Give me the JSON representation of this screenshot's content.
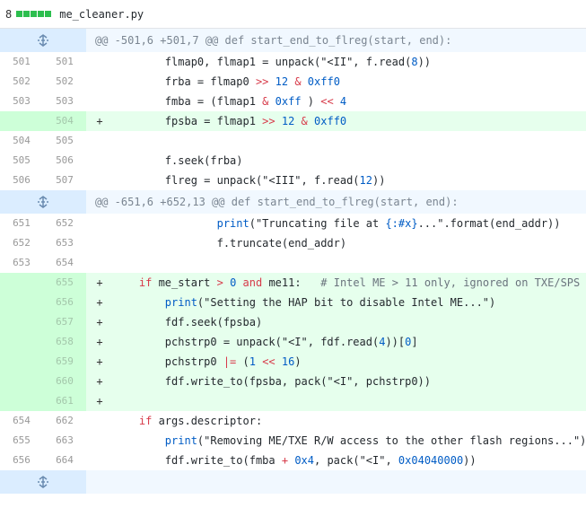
{
  "file": {
    "changes": "8",
    "name": "me_cleaner.py"
  },
  "hunks": [
    {
      "header": "@@ -501,6 +501,7 @@ def start_end_to_flreg(start, end):",
      "lines": [
        {
          "type": "ctx",
          "old": "501",
          "new": "501",
          "tokens": [
            [
              "",
              "        flmap0, flmap1 = unpack(\"<II\", f.read(",
              ""
            ],
            [
              "n",
              "8"
            ],
            [
              "",
              "))"
            ]
          ]
        },
        {
          "type": "ctx",
          "old": "502",
          "new": "502",
          "tokens": [
            [
              "",
              "        frba = flmap0 "
            ],
            [
              "o",
              ">>"
            ],
            [
              "",
              " "
            ],
            [
              "n",
              "12"
            ],
            [
              "",
              " "
            ],
            [
              "o",
              "&"
            ],
            [
              "",
              " "
            ],
            [
              "n",
              "0xff0"
            ]
          ]
        },
        {
          "type": "ctx",
          "old": "503",
          "new": "503",
          "tokens": [
            [
              "",
              "        fmba = (flmap1 "
            ],
            [
              "o",
              "&"
            ],
            [
              "",
              " "
            ],
            [
              "n",
              "0xff"
            ],
            [
              "",
              " ) "
            ],
            [
              "o",
              "<<"
            ],
            [
              "",
              " "
            ],
            [
              "n",
              "4"
            ]
          ]
        },
        {
          "type": "add",
          "old": "",
          "new": "504",
          "tokens": [
            [
              "",
              "        fpsba = flmap1 "
            ],
            [
              "o",
              ">>"
            ],
            [
              "",
              " "
            ],
            [
              "n",
              "12"
            ],
            [
              "",
              " "
            ],
            [
              "o",
              "&"
            ],
            [
              "",
              " "
            ],
            [
              "n",
              "0xff0"
            ]
          ]
        },
        {
          "type": "ctx",
          "old": "504",
          "new": "505",
          "tokens": []
        },
        {
          "type": "ctx",
          "old": "505",
          "new": "506",
          "tokens": [
            [
              "",
              "        f.seek(frba)"
            ]
          ]
        },
        {
          "type": "ctx",
          "old": "506",
          "new": "507",
          "tokens": [
            [
              "",
              "        flreg = unpack(\"<III\", f.read("
            ],
            [
              "n",
              "12"
            ],
            [
              "",
              "))"
            ]
          ]
        }
      ]
    },
    {
      "header": "@@ -651,6 +652,13 @@ def start_end_to_flreg(start, end):",
      "lines": [
        {
          "type": "ctx",
          "old": "651",
          "new": "652",
          "tokens": [
            [
              "",
              "                "
            ],
            [
              "f",
              "print"
            ],
            [
              "",
              "(\"Truncating file at "
            ],
            [
              "n",
              "{:#x}"
            ],
            [
              "",
              "...\".format(end_addr))"
            ]
          ]
        },
        {
          "type": "ctx",
          "old": "652",
          "new": "653",
          "tokens": [
            [
              "",
              "                f.truncate(end_addr)"
            ]
          ]
        },
        {
          "type": "ctx",
          "old": "653",
          "new": "654",
          "tokens": []
        },
        {
          "type": "add",
          "old": "",
          "new": "655",
          "tokens": [
            [
              "",
              "    "
            ],
            [
              "k",
              "if"
            ],
            [
              "",
              " me_start "
            ],
            [
              "o",
              ">"
            ],
            [
              "",
              " "
            ],
            [
              "n",
              "0"
            ],
            [
              "",
              " "
            ],
            [
              "k",
              "and"
            ],
            [
              "",
              " me11:   "
            ],
            [
              "c",
              "# Intel ME > 11 only, ignored on TXE/SPS"
            ]
          ]
        },
        {
          "type": "add",
          "old": "",
          "new": "656",
          "tokens": [
            [
              "",
              "        "
            ],
            [
              "f",
              "print"
            ],
            [
              "",
              "(\"Setting the HAP bit to disable Intel ME...\")"
            ]
          ]
        },
        {
          "type": "add",
          "old": "",
          "new": "657",
          "tokens": [
            [
              "",
              "        fdf.seek(fpsba)"
            ]
          ]
        },
        {
          "type": "add",
          "old": "",
          "new": "658",
          "tokens": [
            [
              "",
              "        pchstrp0 = unpack(\"<I\", fdf.read("
            ],
            [
              "n",
              "4"
            ],
            [
              "",
              "))["
            ],
            [
              "n",
              "0"
            ],
            [
              "",
              "]"
            ]
          ]
        },
        {
          "type": "add",
          "old": "",
          "new": "659",
          "tokens": [
            [
              "",
              "        pchstrp0 "
            ],
            [
              "o",
              "|="
            ],
            [
              "",
              " ("
            ],
            [
              "n",
              "1"
            ],
            [
              "",
              " "
            ],
            [
              "o",
              "<<"
            ],
            [
              "",
              " "
            ],
            [
              "n",
              "16"
            ],
            [
              "",
              ")"
            ]
          ]
        },
        {
          "type": "add",
          "old": "",
          "new": "660",
          "tokens": [
            [
              "",
              "        fdf.write_to(fpsba, pack(\"<I\", pchstrp0))"
            ]
          ]
        },
        {
          "type": "add",
          "old": "",
          "new": "661",
          "tokens": []
        },
        {
          "type": "ctx",
          "old": "654",
          "new": "662",
          "tokens": [
            [
              "",
              "    "
            ],
            [
              "k",
              "if"
            ],
            [
              "",
              " args.descriptor:"
            ]
          ]
        },
        {
          "type": "ctx",
          "old": "655",
          "new": "663",
          "tokens": [
            [
              "",
              "        "
            ],
            [
              "f",
              "print"
            ],
            [
              "",
              "(\"Removing ME/TXE R/W access to the other flash regions...\")"
            ]
          ]
        },
        {
          "type": "ctx",
          "old": "656",
          "new": "664",
          "tokens": [
            [
              "",
              "        fdf.write_to(fmba "
            ],
            [
              "o",
              "+"
            ],
            [
              "",
              " "
            ],
            [
              "n",
              "0x4"
            ],
            [
              "",
              ", pack(\"<I\", "
            ],
            [
              "n",
              "0x04040000"
            ],
            [
              "",
              "))"
            ]
          ]
        }
      ]
    }
  ],
  "colors": {
    "add_bg": "#e6ffed",
    "add_num_bg": "#cdffd8",
    "hunk_bg": "#f1f8ff",
    "expand_bg": "#dbedff",
    "bar_green": "#2cbe4e"
  },
  "expand_icon": "unfold-icon",
  "add_marker": "+"
}
